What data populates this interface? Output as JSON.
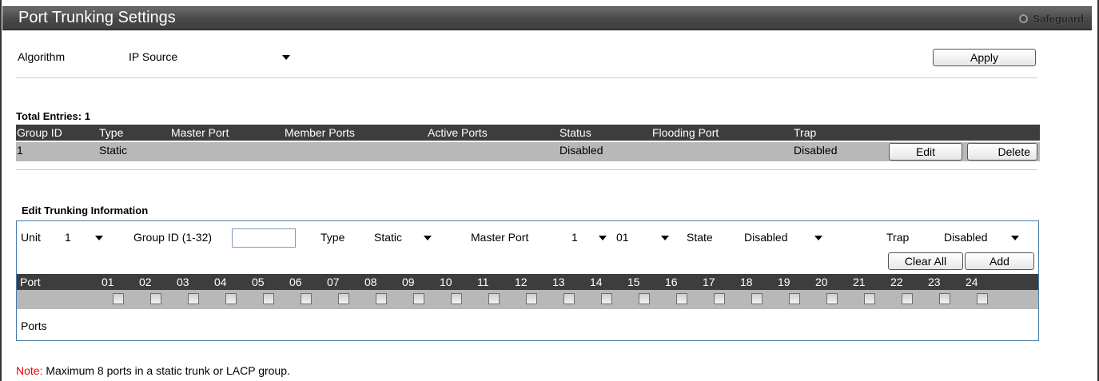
{
  "title": "Port Trunking Settings",
  "safeguard": "Safeguard",
  "algorithm": {
    "label": "Algorithm",
    "value": "IP Source",
    "apply": "Apply"
  },
  "entries": {
    "total": "Total Entries: 1",
    "headers": [
      "Group ID",
      "Type",
      "Master Port",
      "Member Ports",
      "Active Ports",
      "Status",
      "Flooding Port",
      "Trap"
    ],
    "row": {
      "group_id": "1",
      "type": "Static",
      "master_port": "",
      "member_ports": "",
      "active_ports": "",
      "status": "Disabled",
      "flooding_port": "",
      "trap": "Disabled"
    },
    "edit": "Edit",
    "delete": "Delete"
  },
  "edit_section": {
    "heading": "Edit Trunking Information",
    "unit_label": "Unit",
    "unit_value": "1",
    "group_label": "Group ID (1-32)",
    "group_value": "",
    "type_label": "Type",
    "type_value": "Static",
    "master_label": "Master Port",
    "master_unit": "1",
    "master_port": "01",
    "state_label": "State",
    "state_value": "Disabled",
    "trap_label": "Trap",
    "trap_value": "Disabled",
    "clear_all": "Clear All",
    "add": "Add",
    "port_label": "Port",
    "ports": [
      "01",
      "02",
      "03",
      "04",
      "05",
      "06",
      "07",
      "08",
      "09",
      "10",
      "11",
      "12",
      "13",
      "14",
      "15",
      "16",
      "17",
      "18",
      "19",
      "20",
      "21",
      "22",
      "23",
      "24"
    ],
    "ports_label": "Ports"
  },
  "note": {
    "prefix": "Note:",
    "text": " Maximum 8 ports in a static trunk or LACP group."
  }
}
